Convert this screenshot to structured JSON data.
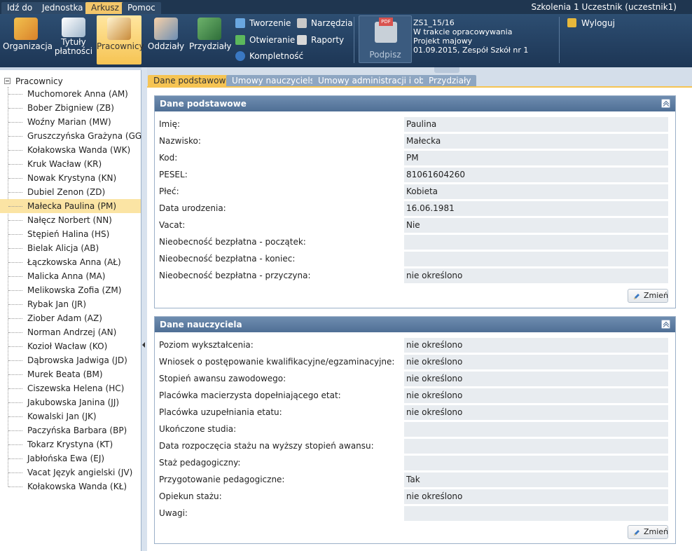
{
  "menubar": {
    "tabs": [
      "Idź do",
      "Jednostka",
      "Arkusz",
      "Pomoc"
    ],
    "user": "Szkolenia 1 Uczestnik (uczestnik1)"
  },
  "toolbar": {
    "organizacja": "Organizacja",
    "tytuly_1": "Tytuły",
    "tytuly_2": "płatności",
    "pracownicy": "Pracownicy",
    "oddzialy": "Oddziały",
    "przydzialy": "Przydziały",
    "tworzenie": "Tworzenie",
    "otwieranie": "Otwieranie",
    "kompletnosc": "Kompletność",
    "narzedzia": "Narzędzia",
    "raporty": "Raporty",
    "podpisz": "Podpisz",
    "info": [
      "ZS1_15/16",
      "W trakcie opracowywania",
      "Projekt majowy",
      "01.09.2015, Zespół Szkół nr 1"
    ],
    "wyloguj": "Wyloguj"
  },
  "tree": {
    "root": "Pracownicy",
    "items": [
      "Muchomorek Anna (AM)",
      "Bober Zbigniew (ZB)",
      "Woźny Marian (MW)",
      "Gruszczyńska Grażyna (GG)",
      "Kołakowska Wanda (WK)",
      "Kruk Wacław (KR)",
      "Nowak Krystyna (KN)",
      "Dubiel Zenon (ZD)",
      "Małecka Paulina (PM)",
      "Nałęcz Norbert (NN)",
      "Stępień Halina (HS)",
      "Bielak Alicja (AB)",
      "Łączkowska Anna (AŁ)",
      "Malicka Anna (MA)",
      "Melikowska Zofia (ZM)",
      "Rybak Jan (JR)",
      "Ziober Adam (AZ)",
      "Norman Andrzej (AN)",
      "Kozioł Wacław (KO)",
      "Dąbrowska Jadwiga (JD)",
      "Murek Beata (BM)",
      "Ciszewska Helena (HC)",
      "Jakubowska Janina (JJ)",
      "Kowalski Jan (JK)",
      "Paczyńska Barbara (BP)",
      "Tokarz Krystyna (KT)",
      "Jabłońska Ewa (EJ)",
      "Vacat Język angielski (JV)",
      "Kołakowska Wanda (KŁ)"
    ]
  },
  "tabs": [
    "Dane podstawowe",
    "Umowy nauczycielskie",
    "Umowy administracji i obsługi",
    "Przydziały"
  ],
  "panel1": {
    "title": "Dane podstawowe",
    "rows": [
      {
        "label": "Imię:",
        "value": "Paulina"
      },
      {
        "label": "Nazwisko:",
        "value": "Małecka"
      },
      {
        "label": "Kod:",
        "value": "PM"
      },
      {
        "label": "PESEL:",
        "value": "81061604260"
      },
      {
        "label": "Płeć:",
        "value": "Kobieta"
      },
      {
        "label": "Data urodzenia:",
        "value": "16.06.1981"
      },
      {
        "label": "Vacat:",
        "value": "Nie"
      },
      {
        "label": "Nieobecność bezpłatna - początek:",
        "value": ""
      },
      {
        "label": "Nieobecność bezpłatna - koniec:",
        "value": ""
      },
      {
        "label": "Nieobecność bezpłatna - przyczyna:",
        "value": "nie określono"
      }
    ],
    "edit": "Zmień"
  },
  "panel2": {
    "title": "Dane nauczyciela",
    "rows": [
      {
        "label": "Poziom wykształcenia:",
        "value": "nie określono"
      },
      {
        "label": "Wniosek o postępowanie kwalifikacyjne/egzaminacyjne:",
        "value": "nie określono"
      },
      {
        "label": "Stopień awansu zawodowego:",
        "value": "nie określono"
      },
      {
        "label": "Placówka macierzysta dopełniającego etat:",
        "value": "nie określono"
      },
      {
        "label": "Placówka uzupełniania etatu:",
        "value": "nie określono"
      },
      {
        "label": "Ukończone studia:",
        "value": ""
      },
      {
        "label": "Data rozpoczęcia stażu na wyższy stopień awansu:",
        "value": ""
      },
      {
        "label": "Staż pedagogiczny:",
        "value": ""
      },
      {
        "label": "Przygotowanie pedagogiczne:",
        "value": "Tak"
      },
      {
        "label": "Opiekun stażu:",
        "value": "nie określono"
      },
      {
        "label": "Uwagi:",
        "value": ""
      }
    ],
    "edit": "Zmień"
  }
}
